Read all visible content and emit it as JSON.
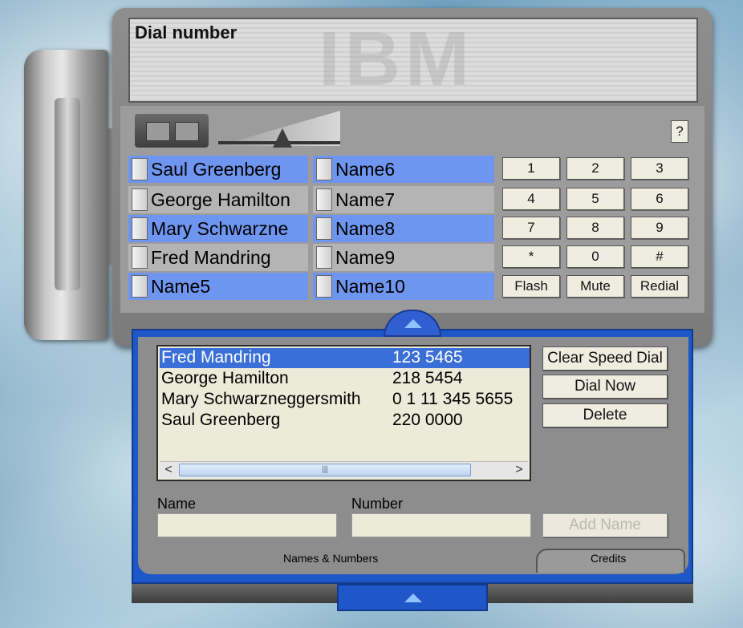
{
  "display": {
    "title": "Dial number",
    "watermark": "IBM"
  },
  "help_label": "?",
  "speed_dial": {
    "left": [
      "Saul Greenberg",
      "George Hamilton",
      "Mary Schwarzne",
      "Fred Mandring",
      "Name5"
    ],
    "right": [
      "Name6",
      "Name7",
      "Name8",
      "Name9",
      "Name10"
    ]
  },
  "keypad": [
    "1",
    "2",
    "3",
    "4",
    "5",
    "6",
    "7",
    "8",
    "9",
    "*",
    "0",
    "#",
    "Flash",
    "Mute",
    "Redial"
  ],
  "list": {
    "rows": [
      {
        "name": "Fred Mandring",
        "number": "123 5465",
        "selected": true
      },
      {
        "name": "George Hamilton",
        "number": "218 5454",
        "selected": false
      },
      {
        "name": "Mary Schwarzneggersmith",
        "number": "0 1 11 345 5655",
        "selected": false
      },
      {
        "name": "Saul Greenberg",
        "number": "220 0000",
        "selected": false
      }
    ],
    "scroll_left": "<",
    "scroll_right": ">",
    "scroll_grip": "|||"
  },
  "actions": {
    "clear_speed_dial": "Clear Speed Dial",
    "dial_now": "Dial Now",
    "delete": "Delete",
    "add_name": "Add Name"
  },
  "form": {
    "name_label": "Name",
    "number_label": "Number",
    "name_value": "",
    "number_value": ""
  },
  "tabs": {
    "names_numbers": "Names & Numbers",
    "credits": "Credits"
  },
  "colors": {
    "speed_dial_blue": "#6e96f0",
    "selection_blue": "#3a6fd7",
    "frame_blue": "#1d57c8"
  }
}
